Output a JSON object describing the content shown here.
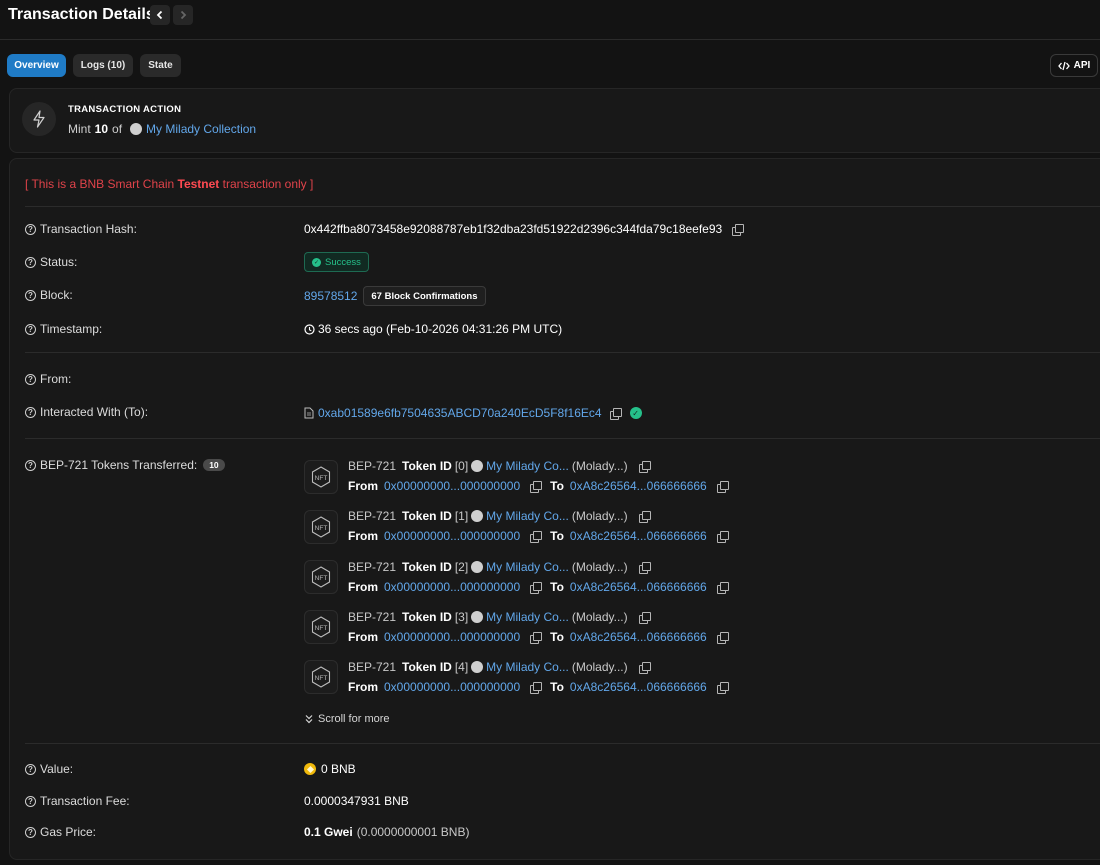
{
  "header": {
    "title": "Transaction Details"
  },
  "tabs": [
    {
      "label": "Overview",
      "active": true
    },
    {
      "label": "Logs (10)",
      "active": false
    },
    {
      "label": "State",
      "active": false
    }
  ],
  "api_label": "API",
  "action": {
    "label": "TRANSACTION ACTION",
    "verb": "Mint",
    "count": "10",
    "of": "of",
    "collection": "My Milady Collection"
  },
  "notice": {
    "prefix": "[ This is a BNB Smart Chain ",
    "bold": "Testnet",
    "suffix": " transaction only ]"
  },
  "fields": {
    "tx_hash": {
      "label": "Transaction Hash:",
      "value": "0x442ffba8073458e92088787eb1f32dba23fd51922d2396c344fda79c18eefe93"
    },
    "status": {
      "label": "Status:",
      "value": "Success"
    },
    "block": {
      "label": "Block:",
      "value": "89578512",
      "confirmations": "67 Block Confirmations"
    },
    "timestamp": {
      "label": "Timestamp:",
      "value": "36 secs ago (Feb-10-2026 04:31:26 PM UTC)"
    },
    "from": {
      "label": "From:",
      "value": ""
    },
    "to": {
      "label": "Interacted With (To):",
      "value": "0xab01589e6fb7504635ABCD70a240EcD5F8f16Ec4"
    },
    "tokens": {
      "label": "BEP-721 Tokens Transferred:",
      "count": "10"
    },
    "value": {
      "label": "Value:",
      "value": "0 BNB"
    },
    "fee": {
      "label": "Transaction Fee:",
      "value": "0.0000347931 BNB"
    },
    "gas": {
      "label": "Gas Price:",
      "value": "0.1 Gwei",
      "sub": "(0.0000000001 BNB)"
    }
  },
  "token_transfers": [
    {
      "standard": "BEP-721",
      "id_label": "Token ID",
      "id": "[0]",
      "collection": "My Milady Co...",
      "symbol": "(Molady...)",
      "from_label": "From",
      "from": "0x00000000...000000000",
      "to_label": "To",
      "to": "0xA8c26564...066666666"
    },
    {
      "standard": "BEP-721",
      "id_label": "Token ID",
      "id": "[1]",
      "collection": "My Milady Co...",
      "symbol": "(Molady...)",
      "from_label": "From",
      "from": "0x00000000...000000000",
      "to_label": "To",
      "to": "0xA8c26564...066666666"
    },
    {
      "standard": "BEP-721",
      "id_label": "Token ID",
      "id": "[2]",
      "collection": "My Milady Co...",
      "symbol": "(Molady...)",
      "from_label": "From",
      "from": "0x00000000...000000000",
      "to_label": "To",
      "to": "0xA8c26564...066666666"
    },
    {
      "standard": "BEP-721",
      "id_label": "Token ID",
      "id": "[3]",
      "collection": "My Milady Co...",
      "symbol": "(Molady...)",
      "from_label": "From",
      "from": "0x00000000...000000000",
      "to_label": "To",
      "to": "0xA8c26564...066666666"
    },
    {
      "standard": "BEP-721",
      "id_label": "Token ID",
      "id": "[4]",
      "collection": "My Milady Co...",
      "symbol": "(Molady...)",
      "from_label": "From",
      "from": "0x00000000...000000000",
      "to_label": "To",
      "to": "0xA8c26564...066666666"
    }
  ],
  "scroll_more": "Scroll for more",
  "colors": {
    "accent": "#1f7bc6",
    "link": "#62a7ea",
    "success": "#25c08a",
    "warning": "#e0434a"
  },
  "icons": [
    "chevron-left-icon",
    "chevron-right-icon",
    "code-icon",
    "lightning-icon",
    "question-icon",
    "copy-icon",
    "clock-icon",
    "file-icon",
    "verified-icon",
    "nft-icon",
    "bnb-icon",
    "chevrons-down-icon"
  ]
}
